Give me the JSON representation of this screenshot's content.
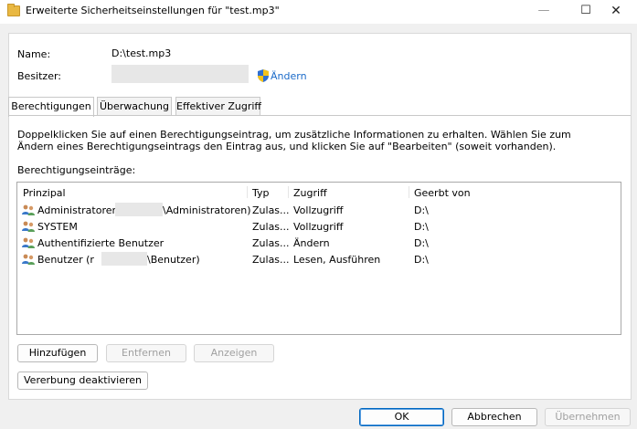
{
  "window": {
    "title": "Erweiterte Sicherheitseinstellungen für \"test.mp3\"",
    "minimize": "—",
    "maximize": "☐",
    "close": "✕"
  },
  "info": {
    "name_label": "Name:",
    "name_value": "D:\\test.mp3",
    "owner_label": "Besitzer:",
    "change_link": "Ändern"
  },
  "tabs": [
    {
      "label": "Berechtigungen",
      "active": true
    },
    {
      "label": "Überwachung",
      "active": false
    },
    {
      "label": "Effektiver Zugriff",
      "active": false
    }
  ],
  "description": "Doppelklicken Sie auf einen Berechtigungseintrag, um zusätzliche Informationen zu erhalten. Wählen Sie zum Ändern eines Berechtigungseintrags den Eintrag aus, und klicken Sie auf \"Bearbeiten\" (soweit vorhanden).",
  "entries_label": "Berechtigungseinträge:",
  "table": {
    "columns": [
      "Prinzipal",
      "Typ",
      "Zugriff",
      "Geerbt von"
    ],
    "rows": [
      {
        "principal_pre": "Administratoren (",
        "principal_post": "\\Administratoren)",
        "type": "Zulas...",
        "access": "Vollzugriff",
        "inherited": "D:\\"
      },
      {
        "principal_pre": "SYSTEM",
        "principal_post": "",
        "type": "Zulas...",
        "access": "Vollzugriff",
        "inherited": "D:\\"
      },
      {
        "principal_pre": "Authentifizierte Benutzer",
        "principal_post": "",
        "type": "Zulas...",
        "access": "Ändern",
        "inherited": "D:\\"
      },
      {
        "principal_pre": "Benutzer (r",
        "principal_post": "\\Benutzer)",
        "type": "Zulas...",
        "access": "Lesen, Ausführen",
        "inherited": "D:\\"
      }
    ]
  },
  "buttons": {
    "add": "Hinzufügen",
    "remove": "Entfernen",
    "view": "Anzeigen",
    "disable_inheritance": "Vererbung deaktivieren",
    "ok": "OK",
    "cancel": "Abbrechen",
    "apply": "Übernehmen"
  },
  "colors": {
    "accent": "#0067c0",
    "link": "#1a6ac9",
    "background": "#f0f0f0"
  }
}
